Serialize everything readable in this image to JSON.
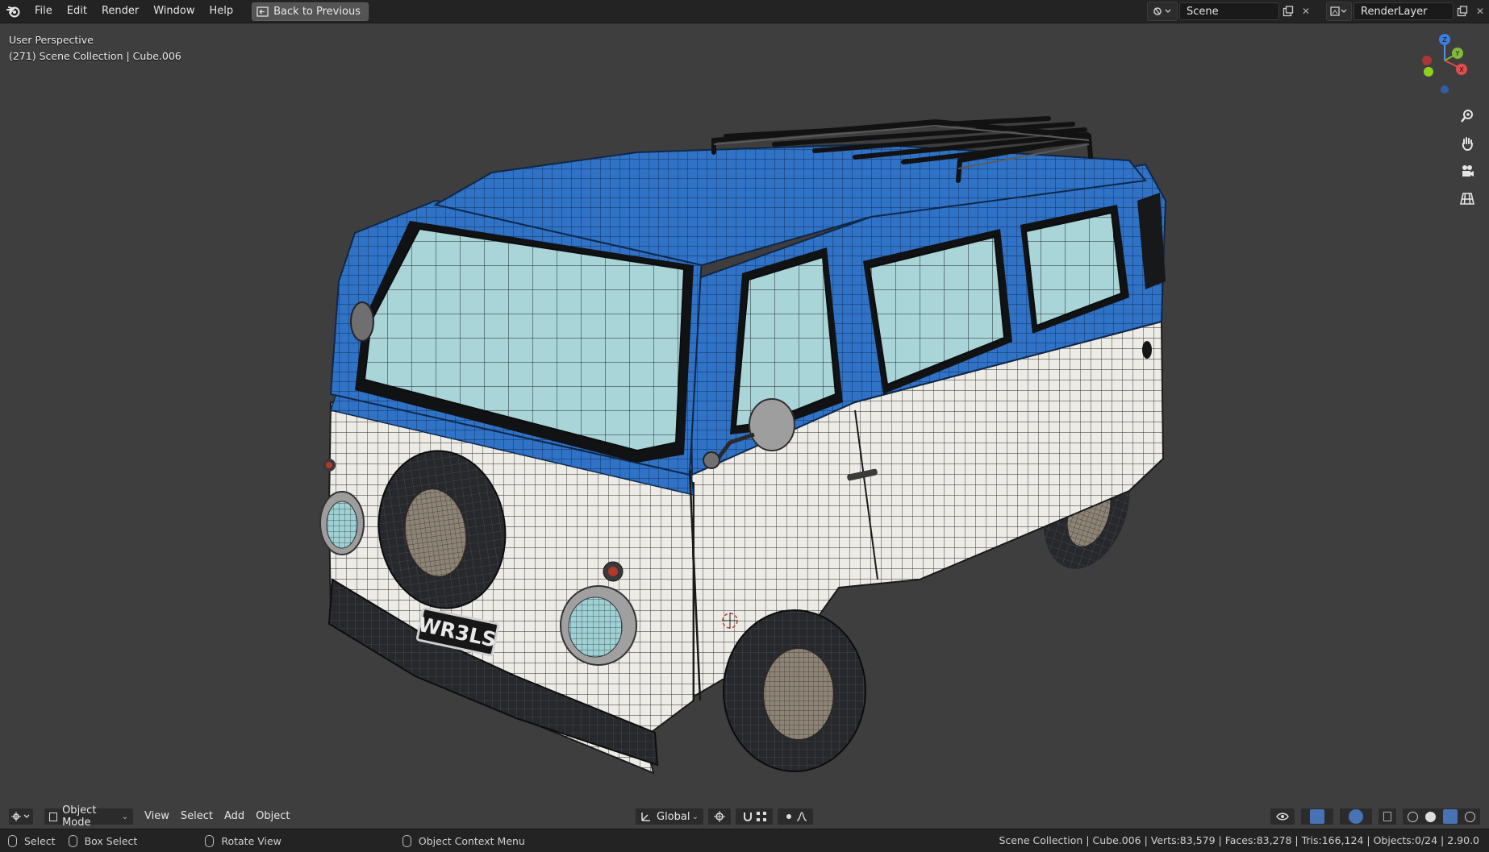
{
  "top_menu": {
    "items": [
      "File",
      "Edit",
      "Render",
      "Window",
      "Help"
    ],
    "back_button": "Back to Previous"
  },
  "scene": {
    "name": "Scene",
    "icon": "scene-icon"
  },
  "render_layer": {
    "name": "RenderLayer",
    "icon": "render-layer-icon"
  },
  "viewport": {
    "perspective": "User Perspective",
    "collection": "(271) Scene Collection | Cube.006",
    "plate_text": "WR3LS"
  },
  "header": {
    "mode": "Object Mode",
    "menus": [
      "View",
      "Select",
      "Add",
      "Object"
    ],
    "transform_orientation": "Global"
  },
  "status": {
    "select": "Select",
    "box_select": "Box Select",
    "rotate_view": "Rotate View",
    "context_menu": "Object Context Menu",
    "stats": "Scene Collection | Cube.006 | Verts:83,579 | Faces:83,278 | Tris:166,124 | Objects:0/24 | 2.90.0"
  },
  "colors": {
    "accent": "#4772b3",
    "van_blue": "#2f72c6",
    "van_white": "#ecebe6",
    "glass": "#a8d3d8"
  }
}
